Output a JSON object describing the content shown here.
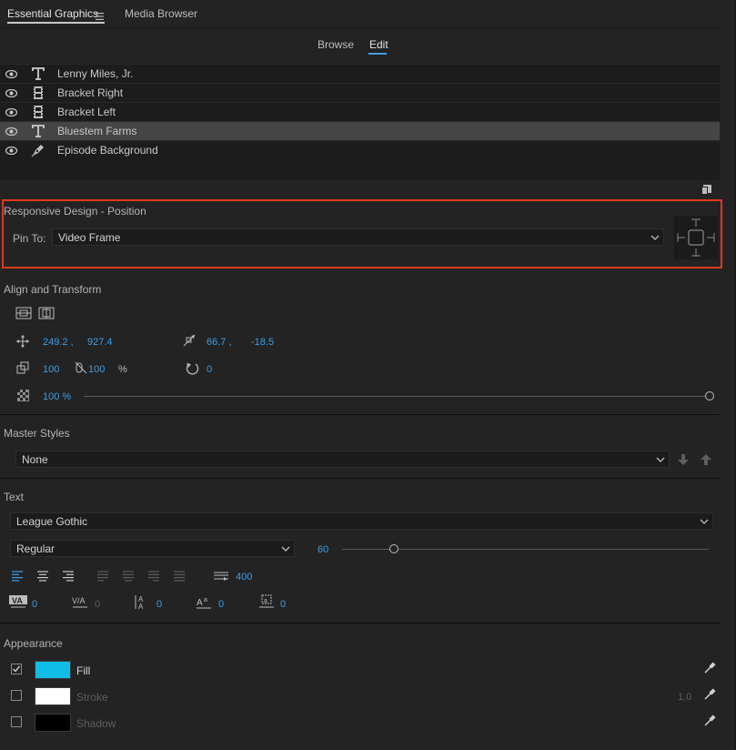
{
  "tabs": {
    "essential_graphics": "Essential Graphics",
    "media_browser": "Media Browser"
  },
  "subtabs": {
    "browse": "Browse",
    "edit": "Edit"
  },
  "layers": [
    {
      "name": "Lenny Miles, Jr.",
      "type": "text",
      "selected": false
    },
    {
      "name": "Bracket Right",
      "type": "clip",
      "selected": false
    },
    {
      "name": "Bracket Left",
      "type": "clip",
      "selected": false
    },
    {
      "name": "Bluestem Farms",
      "type": "text",
      "selected": true
    },
    {
      "name": "Episode Background",
      "type": "shape",
      "selected": false
    }
  ],
  "responsive": {
    "title": "Responsive Design - Position",
    "pin_label": "Pin To:",
    "pin_value": "Video Frame"
  },
  "align": {
    "title": "Align and Transform",
    "position_x": "249.2 ,",
    "position_y": "927.4",
    "anchor_x": "66.7 ,",
    "anchor_y": "-18.5",
    "scale_w": "100",
    "scale_h": "100",
    "scale_unit": "%",
    "rotation": "0",
    "opacity": "100 %"
  },
  "master_styles": {
    "title": "Master Styles",
    "value": "None"
  },
  "text": {
    "title": "Text",
    "font": "League Gothic",
    "style": "Regular",
    "size": "60",
    "size_fraction": 0.14,
    "tab_width": "400",
    "kerning": "0",
    "tracking": "0",
    "leading": "0",
    "baseline": "0",
    "tsume": "0"
  },
  "appearance": {
    "title": "Appearance",
    "fill_label": "Fill",
    "stroke_label": "Stroke",
    "shadow_label": "Shadow",
    "stroke_width": "1.0",
    "fill_color": "#0fbde6",
    "stroke_color": "#ffffff",
    "shadow_color": "#000000"
  },
  "colors": {
    "accent": "#3d9ee9",
    "highlight": "#e0381c"
  }
}
